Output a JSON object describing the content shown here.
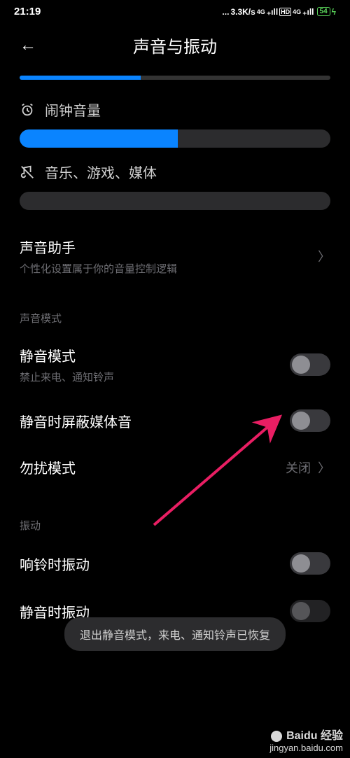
{
  "status": {
    "time": "21:19",
    "speed": "3.3K/s",
    "net1": "4G",
    "hd": "HD",
    "net2": "4G",
    "battery": "54"
  },
  "header": {
    "title": "声音与振动"
  },
  "sliders": {
    "top_partial_pct": 39,
    "alarm": {
      "label": "闹钟音量",
      "pct": 51
    },
    "media": {
      "label": "音乐、游戏、媒体",
      "pct": 0
    }
  },
  "assistant": {
    "title": "声音助手",
    "sub": "个性化设置属于你的音量控制逻辑"
  },
  "groups": {
    "sound_mode": "声音模式",
    "vibration": "振动"
  },
  "items": {
    "silent": {
      "title": "静音模式",
      "sub": "禁止来电、通知铃声"
    },
    "mute_media": {
      "title": "静音时屏蔽媒体音"
    },
    "dnd": {
      "title": "勿扰模式",
      "value": "关闭"
    },
    "vibrate_ring": {
      "title": "响铃时振动"
    },
    "vibrate_silent": {
      "title": "静音时振动"
    }
  },
  "toast": "退出静音模式，来电、通知铃声已恢复",
  "watermark": {
    "brand": "Baidu 经验",
    "url": "jingyan.baidu.com"
  }
}
